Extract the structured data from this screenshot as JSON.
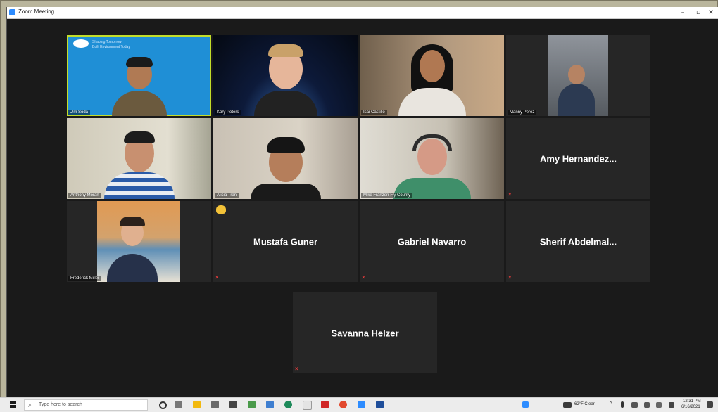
{
  "window": {
    "title": "Zoom Meeting"
  },
  "controls": {
    "minimize": "–",
    "restore": "▫",
    "close": "✕"
  },
  "participants": [
    {
      "name": "Jim Soda"
    },
    {
      "name": "Kory Peters"
    },
    {
      "name": "Isai Castillo"
    },
    {
      "name": "Manny Perez"
    },
    {
      "name": "Anthony Moran"
    },
    {
      "name": "Alicia Tran"
    },
    {
      "name": "Mike Franzen-Fly County"
    },
    {
      "name": "Amy  Hernandez..."
    },
    {
      "name": "Frederick Miller"
    },
    {
      "name": "Mustafa Guner"
    },
    {
      "name": "Gabriel Navarro"
    },
    {
      "name": "Sherif  Abdelmal..."
    },
    {
      "name": "Savanna Helzer"
    }
  ],
  "banner": {
    "line1": "Shaping Tomorrow",
    "line2": "Built Environment Today"
  },
  "taskbar": {
    "search_placeholder": "Type here to search",
    "weather": "62°F Clear",
    "time": "12:31 PM",
    "date": "6/16/2021"
  },
  "colors": {
    "active_speaker": "#c2dd2a",
    "tile_bg": "#262626",
    "muted": "#e23b3b"
  }
}
